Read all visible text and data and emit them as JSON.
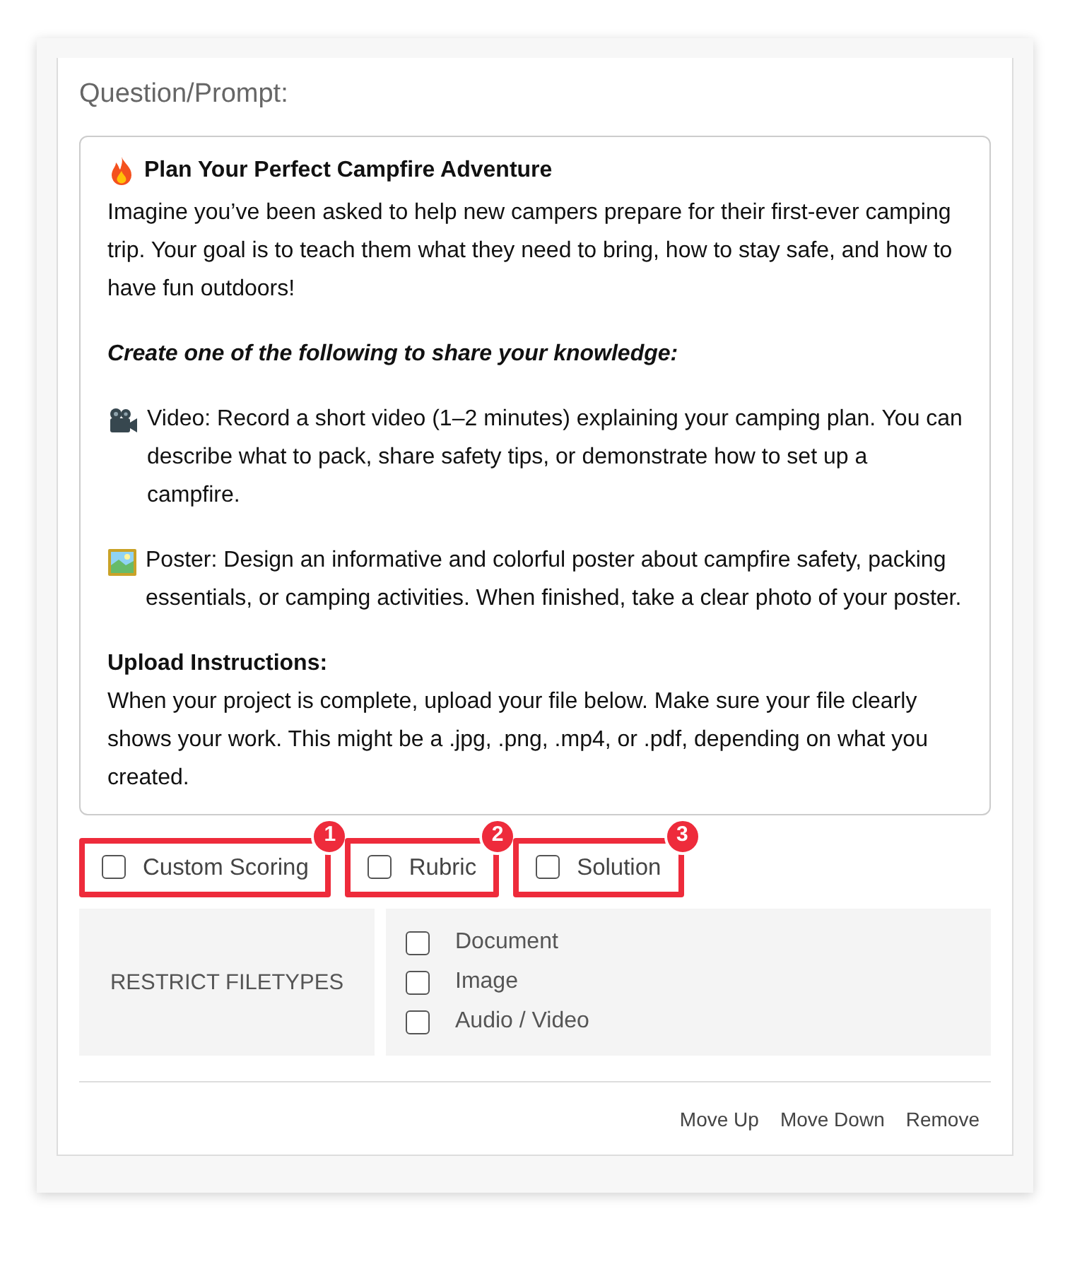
{
  "prompt": {
    "label": "Question/Prompt:",
    "paragraphs": [
      {
        "parts": [
          {
            "kind": "title",
            "text": "Plan Your Perfect Campfire Adventure"
          },
          {
            "kind": "text",
            "text": "Imagine you’ve been asked to help new campers prepare for their first-ever camping trip. Your goal is to teach them what they need to bring, how to stay safe, and how to have fun outdoors!"
          }
        ]
      },
      {
        "parts": [
          {
            "kind": "emphasis",
            "text": "Create one of the following to share your knowledge:"
          }
        ]
      },
      {
        "parts": [
          {
            "kind": "video",
            "text": "Video: Record a short video (1–2 minutes) explaining your camping plan. You can describe what to pack, share safety tips, or demonstrate how to set up a campfire."
          }
        ]
      },
      {
        "parts": [
          {
            "kind": "poster",
            "text": "Poster: Design an informative and colorful poster about campfire safety, packing essentials, or camping activities. When finished, take a clear photo of your poster."
          }
        ]
      },
      {
        "parts": [
          {
            "kind": "heading",
            "text": "Upload Instructions:"
          },
          {
            "kind": "text",
            "text": "When your project is complete, upload your file below. Make sure your file clearly shows your work. This might be a .jpg, .png, .mp4, or .pdf, depending on what you created."
          }
        ]
      }
    ]
  },
  "options": [
    {
      "label": "Custom Scoring",
      "checked": false,
      "callout": "1"
    },
    {
      "label": "Rubric",
      "checked": false,
      "callout": "2"
    },
    {
      "label": "Solution",
      "checked": false,
      "callout": "3"
    }
  ],
  "restrict_filetypes": {
    "label": "RESTRICT FILETYPES",
    "items": [
      {
        "label": "Document",
        "checked": false
      },
      {
        "label": "Image",
        "checked": false
      },
      {
        "label": "Audio / Video",
        "checked": false
      }
    ]
  },
  "actions": [
    "Move Up",
    "Move Down",
    "Remove"
  ]
}
